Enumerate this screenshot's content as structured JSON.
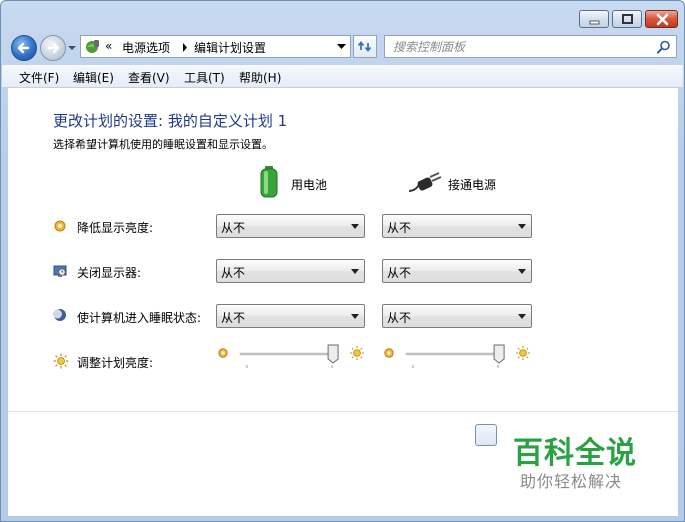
{
  "address": {
    "chevron": "«",
    "crumbs": [
      "电源选项",
      "编辑计划设置"
    ]
  },
  "search": {
    "placeholder": "搜索控制面板"
  },
  "menu": [
    "文件(F)",
    "编辑(E)",
    "查看(V)",
    "工具(T)",
    "帮助(H)"
  ],
  "main": {
    "title": "更改计划的设置: 我的自定义计划 1",
    "description": "选择希望计算机使用的睡眠设置和显示设置。",
    "columns": {
      "battery": "用电池",
      "plugged": "接通电源"
    },
    "rows": [
      {
        "label": "降低显示亮度:",
        "battery": "从不",
        "plugged": "从不",
        "icon": "dim-display-icon"
      },
      {
        "label": "关闭显示器:",
        "battery": "从不",
        "plugged": "从不",
        "icon": "display-off-icon"
      },
      {
        "label": "使计算机进入睡眠状态:",
        "battery": "从不",
        "plugged": "从不",
        "icon": "sleep-moon-icon"
      }
    ],
    "brightness": {
      "label": "调整计划亮度:",
      "battery_level": 0.95,
      "plugged_level": 0.95
    }
  },
  "watermark": {
    "main": "百科全说",
    "sub": "助你轻松解决"
  },
  "colors": {
    "title": "#1e3a8a",
    "watermark_green": "#29a244"
  }
}
